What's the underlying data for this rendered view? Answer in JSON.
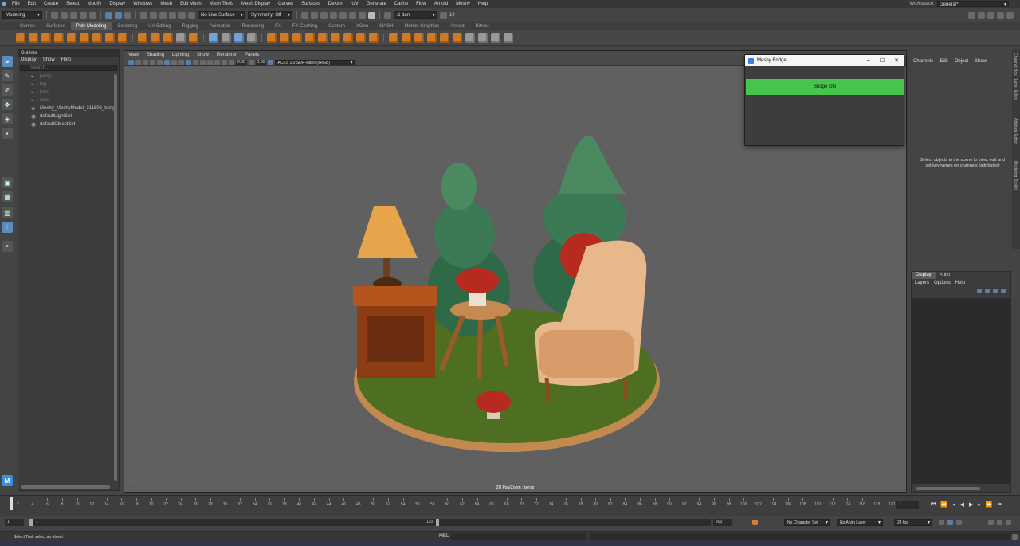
{
  "menubar": {
    "items": [
      "File",
      "Edit",
      "Create",
      "Select",
      "Modify",
      "Display",
      "Windows",
      "Mesh",
      "Edit Mesh",
      "Mesh Tools",
      "Mesh Display",
      "Curves",
      "Surfaces",
      "Deform",
      "UV",
      "Generate",
      "Cache",
      "Flow",
      "Arnold",
      "Meshy",
      "Help"
    ],
    "workspace_label": "Workspace:",
    "workspace_value": "General*"
  },
  "status": {
    "mode": "Modeling",
    "live_surface": "No Live Surface",
    "symmetry": "Symmetry: Off",
    "user": "xi dan",
    "credits": "10"
  },
  "shelf": {
    "tabs": [
      "Curves",
      "Surfaces",
      "Poly Modeling",
      "Sculpting",
      "UV Editing",
      "Rigging",
      "Animation",
      "Rendering",
      "FX",
      "FX Caching",
      "Custom",
      "XGen",
      "MASH",
      "Motion Graphics",
      "Arnold",
      "Bifrost"
    ],
    "active_tab": "Poly Modeling"
  },
  "outliner": {
    "title": "Outliner",
    "menu": [
      "Display",
      "Show",
      "Help"
    ],
    "search_placeholder": "Search...",
    "items": [
      {
        "label": "persp",
        "dim": true
      },
      {
        "label": "top",
        "dim": true
      },
      {
        "label": "front",
        "dim": true
      },
      {
        "label": "side",
        "dim": true
      },
      {
        "label": "Meshy_MeshyModel_211606_temp",
        "dim": false
      },
      {
        "label": "defaultLightSet",
        "dim": false
      },
      {
        "label": "defaultObjectSet",
        "dim": false
      }
    ]
  },
  "viewport": {
    "menu": [
      "View",
      "Shading",
      "Lighting",
      "Show",
      "Renderer",
      "Panels"
    ],
    "exposure": "0.00",
    "gamma": "1.00",
    "color_space": "ACES 1.0 SDR-video (sRGB)",
    "camera_label": "2D Pan/Zoom : persp"
  },
  "meshy_bridge": {
    "title": "Meshy Bridge",
    "button_label": "Bridge ON",
    "button_color": "#46c44b"
  },
  "channel_box": {
    "menu": [
      "Channels",
      "Edit",
      "Object",
      "Show"
    ],
    "message": "Select objects in the scene to view, edit and set keyframes on channels (attributes)"
  },
  "side_tabs": [
    "Channel Box / Layer Editor",
    "Attribute Editor",
    "Modeling Toolkit"
  ],
  "layer_editor": {
    "tabs": [
      "Display",
      "Anim"
    ],
    "menu": [
      "Layers",
      "Options",
      "Help"
    ]
  },
  "timeline": {
    "ticks": [
      "1",
      "2",
      "4",
      "6",
      "8",
      "10",
      "12",
      "14",
      "16",
      "18",
      "20",
      "22",
      "24",
      "26",
      "28",
      "30",
      "32",
      "34",
      "36",
      "38",
      "40",
      "42",
      "44",
      "46",
      "48",
      "50",
      "52",
      "54",
      "56",
      "58",
      "60",
      "62",
      "64",
      "66",
      "68",
      "70",
      "72",
      "74",
      "76",
      "78",
      "80",
      "82",
      "84",
      "86",
      "88",
      "90",
      "92",
      "94",
      "96",
      "98",
      "100",
      "102",
      "104",
      "106",
      "108",
      "110",
      "112",
      "114",
      "116",
      "118",
      "120"
    ],
    "current_frame": "1"
  },
  "range": {
    "start": "1",
    "playback_start": "1",
    "playback_end": "120",
    "end": "200",
    "character_set": "No Character Set",
    "anim_layer": "No Anim Layer",
    "fps": "24 fps"
  },
  "command": {
    "mel_label": "MEL"
  },
  "help_line": "Select Tool: select an object",
  "colors": {
    "accent_blue": "#5b8bbf",
    "shelf_orange": "#d07a28"
  }
}
